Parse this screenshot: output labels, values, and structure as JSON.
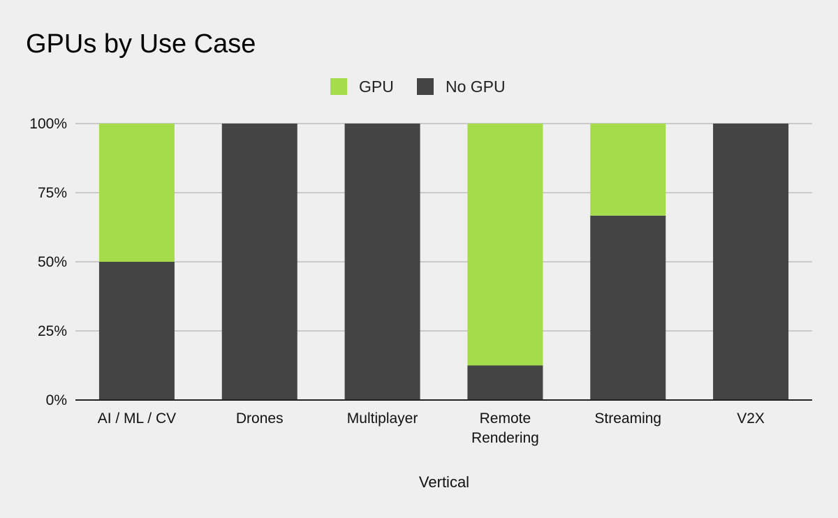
{
  "chart_data": {
    "type": "bar",
    "stacked": true,
    "normalized_percent": true,
    "title": "GPUs by Use Case",
    "xlabel": "Vertical",
    "ylabel": "",
    "categories": [
      [
        "AI / ML / CV"
      ],
      [
        "Drones"
      ],
      [
        "Multiplayer"
      ],
      [
        "Remote",
        "Rendering"
      ],
      [
        "Streaming"
      ],
      [
        "V2X"
      ]
    ],
    "series": [
      {
        "name": "No GPU",
        "color": "#444444",
        "values": [
          50,
          100,
          100,
          12.5,
          66.7,
          100
        ]
      },
      {
        "name": "GPU",
        "color": "#a5dc4b",
        "values": [
          50,
          0,
          0,
          87.5,
          33.3,
          0
        ]
      }
    ],
    "legend_order": [
      "GPU",
      "No GPU"
    ],
    "legend_position": "top-center",
    "ylim": [
      0,
      100
    ],
    "yticks": [
      0,
      25,
      50,
      75,
      100
    ],
    "ytick_labels": [
      "0%",
      "25%",
      "50%",
      "75%",
      "100%"
    ],
    "grid": true
  }
}
